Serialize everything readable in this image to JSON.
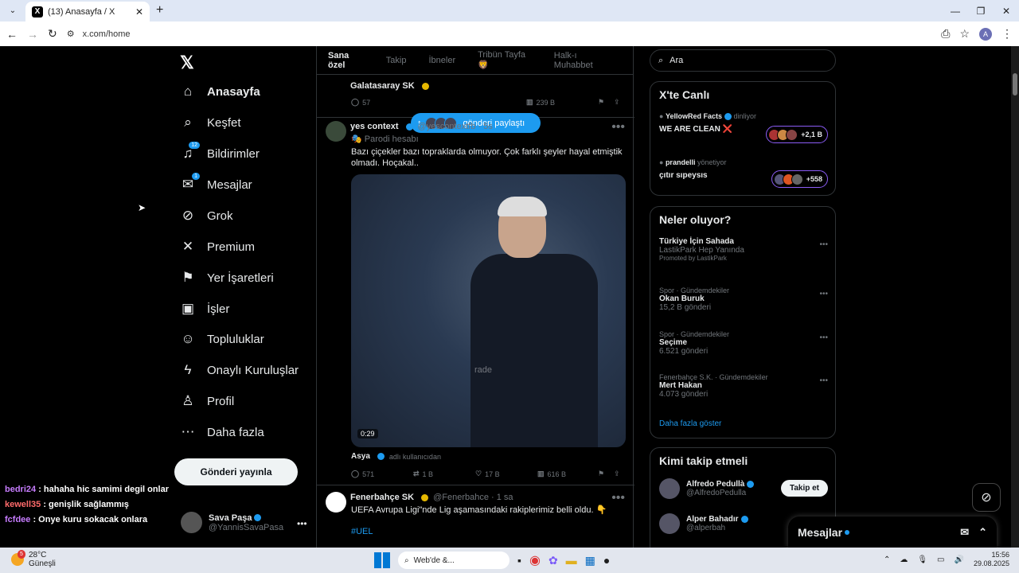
{
  "browser": {
    "tab_title": "(13) Anasayfa / X",
    "url": "x.com/home",
    "profile": "A"
  },
  "nav": {
    "items": [
      {
        "label": "Anasayfa",
        "icon": "home-icon",
        "glyph": "⌂"
      },
      {
        "label": "Keşfet",
        "icon": "search-icon",
        "glyph": "⌕"
      },
      {
        "label": "Bildirimler",
        "icon": "bell-icon",
        "glyph": "♫",
        "badge": "12"
      },
      {
        "label": "Mesajlar",
        "icon": "mail-icon",
        "glyph": "✉",
        "badge": "1"
      },
      {
        "label": "Grok",
        "icon": "grok-icon",
        "glyph": "⊘"
      },
      {
        "label": "Premium",
        "icon": "x-icon",
        "glyph": "✕"
      },
      {
        "label": "Yer İşaretleri",
        "icon": "bookmark-icon",
        "glyph": "⚑"
      },
      {
        "label": "İşler",
        "icon": "briefcase-icon",
        "glyph": "▣"
      },
      {
        "label": "Topluluklar",
        "icon": "people-icon",
        "glyph": "☺"
      },
      {
        "label": "Onaylı Kuruluşlar",
        "icon": "lightning-icon",
        "glyph": "ϟ"
      },
      {
        "label": "Profil",
        "icon": "person-icon",
        "glyph": "♙"
      },
      {
        "label": "Daha fazla",
        "icon": "more-circle-icon",
        "glyph": "⋯"
      }
    ],
    "post_button": "Gönderi yayınla"
  },
  "user": {
    "name": "Sava Paşa",
    "handle": "@YannisSavaPasa"
  },
  "chat": [
    {
      "user": "bedri24",
      "msg": " : hahaha hic samimi degil onlar",
      "color": "#c77dff"
    },
    {
      "user": "kewell35",
      "msg": " : genişlik sağlammış",
      "color": "#ff6b6b"
    },
    {
      "user": "fcfdee",
      "msg": " : Onye kuru sokacak onlara",
      "color": "#c77dff"
    }
  ],
  "feed": {
    "tabs": [
      "Sana özel",
      "Takip",
      "İbneler",
      "Tribün Tayfa 🦁",
      "Halk-ı Muhabbet"
    ],
    "toast": "gönderi paylaştı",
    "post0": {
      "name": "Galatasaray SK",
      "replies": "57",
      "views": "239 B"
    },
    "post1": {
      "name": "yes context",
      "handle": "@yescontextfb · 5s",
      "sub": "Parodi hesabı",
      "text": "Bazı çiçekler bazı topraklarda olmuyor. Çok farklı şeyler hayal etmiştik olmadı. Hoçakal..",
      "duration": "0:29",
      "watermark": "rade",
      "credit_name": "Asya",
      "credit_sub": "adlı kullanıcıdan",
      "replies": "571",
      "reposts": "1 B",
      "likes": "17 B",
      "views": "616 B"
    },
    "post2": {
      "name": "Fenerbahçe SK",
      "handle": "@Fenerbahce · 1 sa",
      "text": "UEFA Avrupa Ligi\"nde Lig aşamasındaki rakiplerimiz belli oldu. 👇",
      "hashtag": "#UEL"
    }
  },
  "right": {
    "search_placeholder": "Ara",
    "live": {
      "title": "X'te Canlı",
      "s1_host": "YellowRed Facts",
      "s1_status": "dinliyor",
      "s1_title": "WE ARE CLEAN ❌",
      "s1_count": "+2,1 B",
      "s2_host": "prandelli",
      "s2_status": "yönetiyor",
      "s2_title": "çıtır sıpeysıs",
      "s2_count": "+558"
    },
    "trends": {
      "title": "Neler oluyor?",
      "items": [
        {
          "meta": "",
          "title": "Türkiye İçin Sahada",
          "sub": "LastikPark Hep Yanında",
          "extra": "Promoted by LastikPark"
        },
        {
          "meta": "Spor · Gündemdekiler",
          "title": "Okan Buruk",
          "sub": "15,2 B gönderi"
        },
        {
          "meta": "Spor · Gündemdekiler",
          "title": "Seçime",
          "sub": "6.521 gönderi"
        },
        {
          "meta": "Fenerbahçe S.K. · Gündemdekiler",
          "title": "Mert Hakan",
          "sub": "4.073 gönderi"
        }
      ],
      "more": "Daha fazla göster"
    },
    "follow": {
      "title": "Kimi takip etmeli",
      "items": [
        {
          "name": "Alfredo Pedullà",
          "handle": "@AlfredoPedulla",
          "btn": "Takip et"
        },
        {
          "name": "Alper Bahadır",
          "handle": "@alperbah"
        }
      ]
    },
    "messages": "Mesajlar"
  },
  "taskbar": {
    "temp": "28°C",
    "weather": "Güneşli",
    "weather_badge": "5",
    "search": "Web'de &...",
    "time": "15:56",
    "date": "29.08.2025"
  }
}
